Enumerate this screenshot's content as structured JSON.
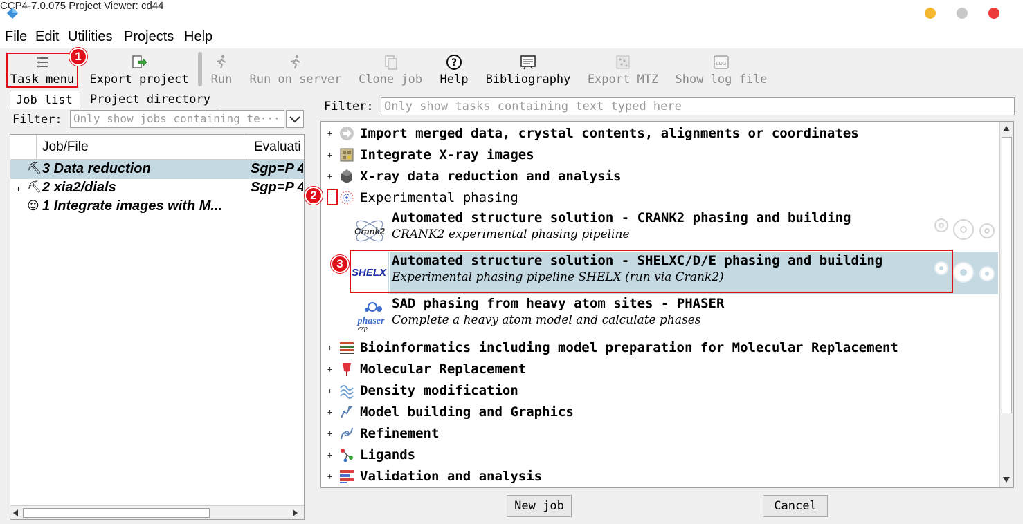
{
  "window": {
    "title": "CCP4-7.0.075 Project Viewer: cd44",
    "controls": {
      "minimize_color": "#f5b82e",
      "maximize_color": "#c8c8c8",
      "close_color": "#ec3b3b"
    }
  },
  "menubar": {
    "items": [
      "File",
      "Edit",
      "Utilities",
      "Projects",
      "Help"
    ]
  },
  "toolbar": {
    "task_menu": "Task menu",
    "export_project": "Export project",
    "run": "Run",
    "run_on_server": "Run on server",
    "clone_job": "Clone job",
    "help": "Help",
    "bibliography": "Bibliography",
    "export_mtz": "Export MTZ",
    "show_log_file": "Show log file"
  },
  "annotations": {
    "badge1": "1",
    "badge2": "2",
    "badge3": "3",
    "accent": "#e0101a"
  },
  "left_pane": {
    "tabs": [
      "Job list",
      "Project directory"
    ],
    "filter_label": "Filter:",
    "filter_placeholder": "Only show jobs containing te···",
    "columns": [
      "Job/File",
      "Evaluati"
    ],
    "jobs": [
      {
        "expander": "",
        "icon": "hammer",
        "name": "3 Data reduction",
        "evaluation": "Sgp=P 4",
        "selected": true
      },
      {
        "expander": "+",
        "icon": "hammer",
        "name": "2 xia2/dials",
        "evaluation": "Sgp=P 4",
        "selected": false
      },
      {
        "expander": "",
        "icon": "smiley",
        "name": "1 Integrate images with M...",
        "evaluation": "",
        "selected": false
      }
    ]
  },
  "right_pane": {
    "filter_label": "Filter:",
    "filter_placeholder": "Only show tasks containing text typed here",
    "categories_top": [
      {
        "label": "Import merged data, crystal contents, alignments or coordinates",
        "icon": "import-arrow-icon"
      },
      {
        "label": "Integrate X-ray images",
        "icon": "detector-icon"
      },
      {
        "label": "X-ray data reduction and analysis",
        "icon": "aimless-icon"
      },
      {
        "label": "Experimental phasing",
        "icon": "phasing-icon",
        "expanded": true
      }
    ],
    "tasks": [
      {
        "title": "Automated structure solution - CRANK2 phasing and building",
        "description": "CRANK2 experimental phasing pipeline",
        "logo": "Crank2",
        "selected": false
      },
      {
        "title": "Automated structure solution - SHELXC/D/E phasing and building",
        "description": "Experimental phasing pipeline SHELX (run via Crank2)",
        "logo": "SHELX",
        "selected": true
      },
      {
        "title": "SAD phasing from heavy atom sites - PHASER",
        "description": "Complete a heavy atom model and calculate phases",
        "logo": "phaser",
        "logo_sub": "exp",
        "selected": false
      }
    ],
    "categories_bottom": [
      {
        "label": "Bioinformatics including model preparation for Molecular Replacement",
        "icon": "bioinformatics-icon"
      },
      {
        "label": "Molecular Replacement",
        "icon": "molrep-icon"
      },
      {
        "label": "Density modification",
        "icon": "density-icon"
      },
      {
        "label": "Model building and Graphics",
        "icon": "model-building-icon"
      },
      {
        "label": "Refinement",
        "icon": "refinement-icon"
      },
      {
        "label": "Ligands",
        "icon": "ligand-icon"
      },
      {
        "label": "Validation and analysis",
        "icon": "validation-icon"
      }
    ],
    "selected_row_color": "#c5d9e3"
  },
  "buttons": {
    "new_job": "New job",
    "cancel": "Cancel"
  }
}
